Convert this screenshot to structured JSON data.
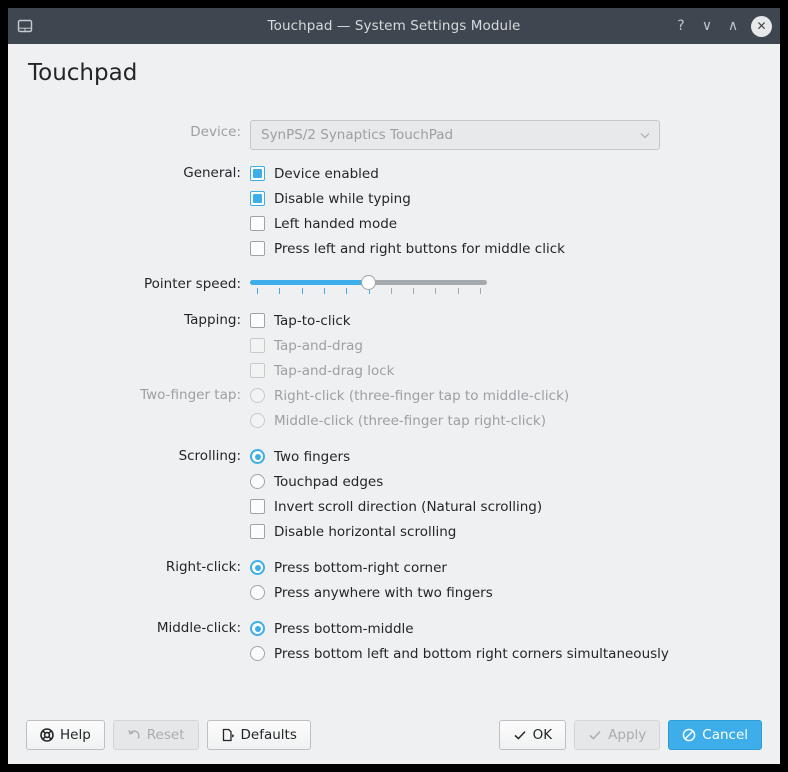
{
  "window": {
    "title": "Touchpad — System Settings Module",
    "icon": "touchpad-icon",
    "controls": {
      "help": "?",
      "minimize": "∨",
      "maximize": "∧",
      "close": "✕"
    }
  },
  "page": {
    "heading": "Touchpad"
  },
  "device": {
    "label": "Device:",
    "value": "SynPS/2 Synaptics TouchPad",
    "enabled": false,
    "options": [
      "SynPS/2 Synaptics TouchPad"
    ]
  },
  "general": {
    "label": "General:",
    "items": [
      {
        "label": "Device enabled",
        "checked": true,
        "enabled": true
      },
      {
        "label": "Disable while typing",
        "checked": true,
        "enabled": true
      },
      {
        "label": "Left handed mode",
        "checked": false,
        "enabled": true
      },
      {
        "label": "Press left and right buttons for middle click",
        "checked": false,
        "enabled": true
      }
    ]
  },
  "pointer_speed": {
    "label": "Pointer speed:",
    "value_percent": 50,
    "tick_count": 11
  },
  "tapping": {
    "label": "Tapping:",
    "items": [
      {
        "label": "Tap-to-click",
        "checked": false,
        "enabled": true
      },
      {
        "label": "Tap-and-drag",
        "checked": false,
        "enabled": false
      },
      {
        "label": "Tap-and-drag lock",
        "checked": false,
        "enabled": false
      }
    ]
  },
  "two_finger_tap": {
    "label": "Two-finger tap:",
    "enabled": false,
    "items": [
      {
        "label": "Right-click (three-finger tap to middle-click)",
        "selected": false,
        "enabled": false
      },
      {
        "label": "Middle-click (three-finger tap right-click)",
        "selected": false,
        "enabled": false
      }
    ]
  },
  "scrolling": {
    "label": "Scrolling:",
    "radios": [
      {
        "label": "Two fingers",
        "selected": true,
        "enabled": true
      },
      {
        "label": "Touchpad edges",
        "selected": false,
        "enabled": true
      }
    ],
    "checks": [
      {
        "label": "Invert scroll direction (Natural scrolling)",
        "checked": false,
        "enabled": true
      },
      {
        "label": "Disable horizontal scrolling",
        "checked": false,
        "enabled": true
      }
    ]
  },
  "right_click": {
    "label": "Right-click:",
    "items": [
      {
        "label": "Press bottom-right corner",
        "selected": true,
        "enabled": true
      },
      {
        "label": "Press anywhere with two fingers",
        "selected": false,
        "enabled": true
      }
    ]
  },
  "middle_click": {
    "label": "Middle-click:",
    "items": [
      {
        "label": "Press bottom-middle",
        "selected": true,
        "enabled": true
      },
      {
        "label": "Press bottom left and bottom right corners simultaneously",
        "selected": false,
        "enabled": true
      }
    ]
  },
  "buttons": {
    "help": {
      "label": "Help",
      "icon": "lifebuoy-icon",
      "enabled": true
    },
    "reset": {
      "label": "Reset",
      "icon": "undo-arrow-icon",
      "enabled": false
    },
    "defaults": {
      "label": "Defaults",
      "icon": "document-revert-icon",
      "enabled": true
    },
    "ok": {
      "label": "OK",
      "icon": "check-icon",
      "enabled": true
    },
    "apply": {
      "label": "Apply",
      "icon": "check-icon",
      "enabled": false
    },
    "cancel": {
      "label": "Cancel",
      "icon": "no-entry-icon",
      "enabled": true
    }
  },
  "colors": {
    "accent": "#3daee9",
    "titlebar": "#3e4750",
    "background": "#eff0f1",
    "text": "#232629",
    "disabled_text": "#9ba0a4"
  }
}
